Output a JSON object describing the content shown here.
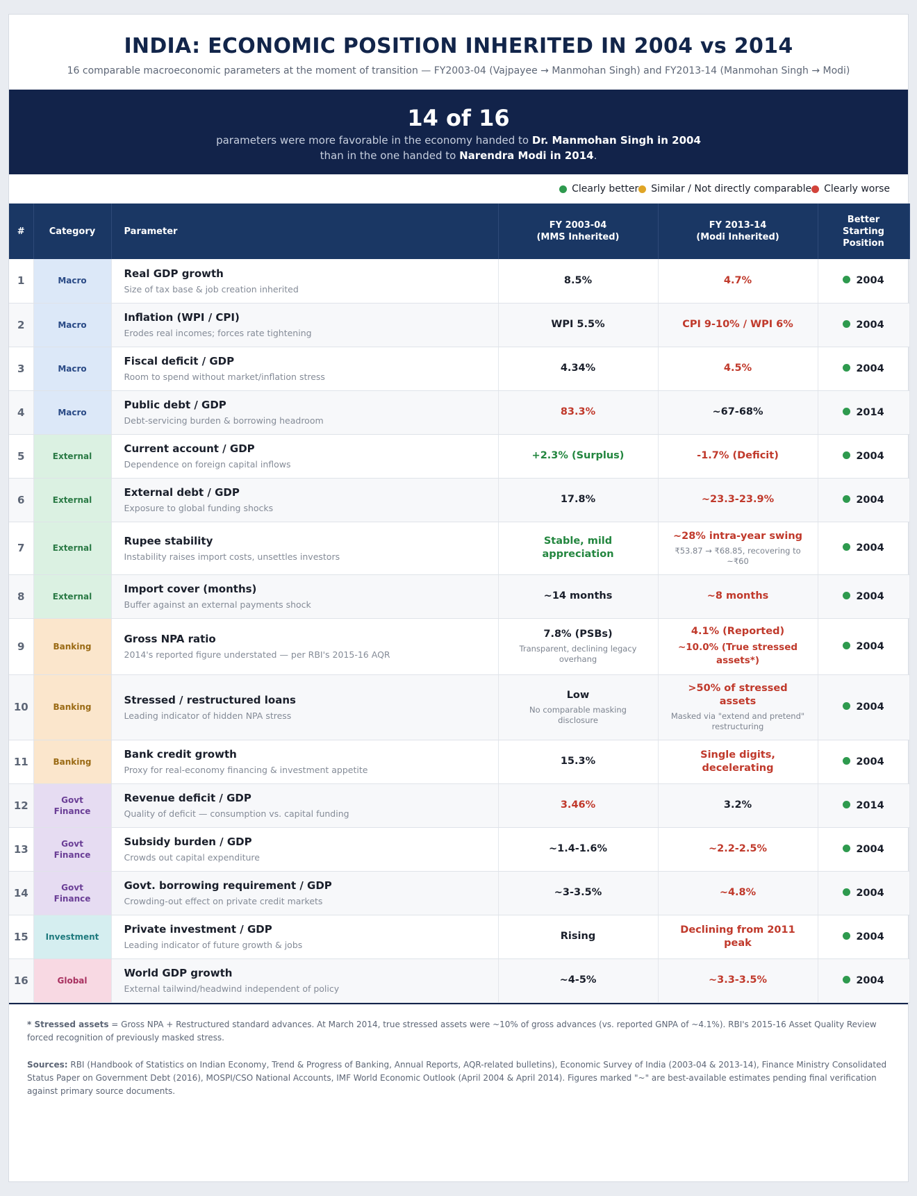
{
  "header": {
    "title": "INDIA: ECONOMIC POSITION INHERITED IN 2004 vs 2014",
    "subtitle": "16 comparable macroeconomic parameters at the moment of transition — FY2003-04 (Vajpayee → Manmohan Singh) and FY2013-14 (Manmohan Singh → Modi)"
  },
  "banner": {
    "headline": "14 of 16",
    "line1_pre": "parameters were more favorable in the economy handed to ",
    "line1_bold": "Dr. Manmohan Singh in 2004",
    "line2_pre": "than in the one handed to ",
    "line2_bold": "Narendra Modi in 2014",
    "line2_post": "."
  },
  "legend": [
    {
      "label": "Clearly better",
      "color": "#2e9a4e"
    },
    {
      "label": "Similar / Not directly comparable",
      "color": "#e0a526"
    },
    {
      "label": "Clearly worse",
      "color": "#d2433a"
    }
  ],
  "columns": {
    "num": "#",
    "category": "Category",
    "parameter": "Parameter",
    "fy04_line1": "FY 2003-04",
    "fy04_line2": "(MMS Inherited)",
    "fy14_line1": "FY 2013-14",
    "fy14_line2": "(Modi Inherited)",
    "better_line1": "Better",
    "better_line2": "Starting",
    "better_line3": "Position"
  },
  "category_styles": {
    "Macro": {
      "bg": "#dce8f8",
      "fg": "#2a4a86"
    },
    "External": {
      "bg": "#dbf1e2",
      "fg": "#2a7a45"
    },
    "Banking": {
      "bg": "#fbe6cc",
      "fg": "#9a6a14"
    },
    "Govt Finance": {
      "bg": "#e6dcf2",
      "fg": "#6a3e96"
    },
    "Investment": {
      "bg": "#d5eef0",
      "fg": "#1f7a7e"
    },
    "Global": {
      "bg": "#f8d9e3",
      "fg": "#a83160"
    }
  },
  "rows": [
    {
      "num": "1",
      "category": "Macro",
      "name": "Real GDP growth",
      "desc": "Size of tax base & job creation inherited",
      "fy04": "8.5%",
      "fy04_tone": "neutral",
      "fy14": "4.7%",
      "fy14_tone": "red",
      "better": "2004"
    },
    {
      "num": "2",
      "category": "Macro",
      "name": "Inflation (WPI / CPI)",
      "desc": "Erodes real incomes; forces rate tightening",
      "fy04": "WPI 5.5%",
      "fy04_tone": "neutral",
      "fy14": "CPI 9-10% / WPI 6%",
      "fy14_tone": "red",
      "better": "2004"
    },
    {
      "num": "3",
      "category": "Macro",
      "name": "Fiscal deficit / GDP",
      "desc": "Room to spend without market/inflation stress",
      "fy04": "4.34%",
      "fy04_tone": "neutral",
      "fy14": "4.5%",
      "fy14_tone": "red",
      "better": "2004"
    },
    {
      "num": "4",
      "category": "Macro",
      "name": "Public debt / GDP",
      "desc": "Debt-servicing burden & borrowing headroom",
      "fy04": "83.3%",
      "fy04_tone": "red",
      "fy14": "~67-68%",
      "fy14_tone": "neutral",
      "better": "2014"
    },
    {
      "num": "5",
      "category": "External",
      "name": "Current account / GDP",
      "desc": "Dependence on foreign capital inflows",
      "fy04": "+2.3% (Surplus)",
      "fy04_tone": "green",
      "fy14": "-1.7% (Deficit)",
      "fy14_tone": "red",
      "better": "2004"
    },
    {
      "num": "6",
      "category": "External",
      "name": "External debt / GDP",
      "desc": "Exposure to global funding shocks",
      "fy04": "17.8%",
      "fy04_tone": "neutral",
      "fy14": "~23.3-23.9%",
      "fy14_tone": "red",
      "better": "2004"
    },
    {
      "num": "7",
      "category": "External",
      "name": "Rupee stability",
      "desc": "Instability raises import costs, unsettles investors",
      "fy04": "Stable, mild appreciation",
      "fy04_tone": "green",
      "fy14": "~28% intra-year swing",
      "fy14_tone": "red",
      "fy14_sub": "₹53.87 → ₹68.85, recovering to ~₹60",
      "better": "2004"
    },
    {
      "num": "8",
      "category": "External",
      "name": "Import cover (months)",
      "desc": "Buffer against an external payments shock",
      "fy04": "~14 months",
      "fy04_tone": "neutral",
      "fy14": "~8 months",
      "fy14_tone": "red",
      "better": "2004"
    },
    {
      "num": "9",
      "category": "Banking",
      "name": "Gross NPA ratio",
      "desc": "2014's reported figure understated — per RBI's 2015-16 AQR",
      "fy04": "7.8% (PSBs)",
      "fy04_tone": "neutral",
      "fy04_sub": "Transparent, declining legacy overhang",
      "fy14": "4.1% (Reported)",
      "fy14_tone": "red",
      "fy14_extra": "~10.0% (True stressed assets*)",
      "better": "2004"
    },
    {
      "num": "10",
      "category": "Banking",
      "name": "Stressed / restructured loans",
      "desc": "Leading indicator of hidden NPA stress",
      "fy04": "Low",
      "fy04_tone": "neutral",
      "fy04_sub": "No comparable masking disclosure",
      "fy14": ">50% of stressed assets",
      "fy14_tone": "red",
      "fy14_sub": "Masked via \"extend and pretend\" restructuring",
      "better": "2004"
    },
    {
      "num": "11",
      "category": "Banking",
      "name": "Bank credit growth",
      "desc": "Proxy for real-economy financing & investment appetite",
      "fy04": "15.3%",
      "fy04_tone": "neutral",
      "fy14": "Single digits, decelerating",
      "fy14_tone": "red",
      "better": "2004"
    },
    {
      "num": "12",
      "category": "Govt Finance",
      "name": "Revenue deficit / GDP",
      "desc": "Quality of deficit — consumption vs. capital funding",
      "fy04": "3.46%",
      "fy04_tone": "red",
      "fy14": "3.2%",
      "fy14_tone": "neutral",
      "better": "2014"
    },
    {
      "num": "13",
      "category": "Govt Finance",
      "name": "Subsidy burden / GDP",
      "desc": "Crowds out capital expenditure",
      "fy04": "~1.4-1.6%",
      "fy04_tone": "neutral",
      "fy14": "~2.2-2.5%",
      "fy14_tone": "red",
      "better": "2004"
    },
    {
      "num": "14",
      "category": "Govt Finance",
      "name": "Govt. borrowing requirement / GDP",
      "desc": "Crowding-out effect on private credit markets",
      "fy04": "~3-3.5%",
      "fy04_tone": "neutral",
      "fy14": "~4.8%",
      "fy14_tone": "red",
      "better": "2004"
    },
    {
      "num": "15",
      "category": "Investment",
      "name": "Private investment / GDP",
      "desc": "Leading indicator of future growth & jobs",
      "fy04": "Rising",
      "fy04_tone": "neutral",
      "fy14": "Declining from 2011 peak",
      "fy14_tone": "red",
      "better": "2004"
    },
    {
      "num": "16",
      "category": "Global",
      "name": "World GDP growth",
      "desc": "External tailwind/headwind independent of policy",
      "fy04": "~4-5%",
      "fy04_tone": "neutral",
      "fy14": "~3.3-3.5%",
      "fy14_tone": "red",
      "better": "2004"
    }
  ],
  "better_dot_color": "#2e9a4e",
  "footer": {
    "note_label": "* Stressed assets",
    "note_text": " = Gross NPA + Restructured standard advances. At March 2014, true stressed assets were ~10% of gross advances (vs. reported GNPA of ~4.1%). RBI's 2015-16 Asset Quality Review forced recognition of previously masked stress.",
    "sources_label": "Sources:",
    "sources_text": " RBI (Handbook of Statistics on Indian Economy, Trend & Progress of Banking, Annual Reports, AQR-related bulletins), Economic Survey of India (2003-04 & 2013-14), Finance Ministry Consolidated Status Paper on Government Debt (2016), MOSPI/CSO National Accounts, IMF World Economic Outlook (April 2004 & April 2014). Figures marked \"~\" are best-available estimates pending final verification against primary source documents."
  }
}
